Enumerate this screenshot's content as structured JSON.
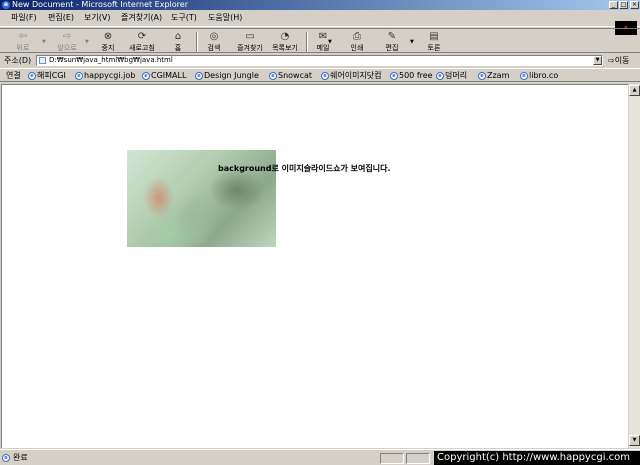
{
  "window": {
    "title": "New Document - Microsoft Internet Explorer",
    "controls": [
      "_",
      "□",
      "×"
    ]
  },
  "menu": {
    "items": [
      "파일(F)",
      "편집(E)",
      "보기(V)",
      "즐겨찾기(A)",
      "도구(T)",
      "도움말(H)"
    ]
  },
  "toolbar": {
    "back": "뒤로",
    "forward": "앞으로",
    "stop": "중지",
    "refresh": "새로고침",
    "home": "홈",
    "search": "검색",
    "favorites": "즐겨찾기",
    "history": "목록보기",
    "mail": "메일",
    "print": "인쇄",
    "edit": "편집",
    "discuss": "토론"
  },
  "address": {
    "label": "주소(D)",
    "value": "D:₩sun₩java_html₩bg₩java.html",
    "go": "이동"
  },
  "links": {
    "label": "연결",
    "items": [
      "해피CGI",
      "happycgi.job",
      "CGIMALL",
      "Design Jungle",
      "Snowcat",
      "쉐어이미지닷컴",
      "500 free",
      "덩머리",
      "Zzam",
      "libro.co"
    ]
  },
  "content": {
    "caption": "background로 이미지슬라이드쇼가 보여집니다."
  },
  "status": {
    "text": "완료",
    "copyright": "Copyright(c) http://www.happycgi.com"
  }
}
